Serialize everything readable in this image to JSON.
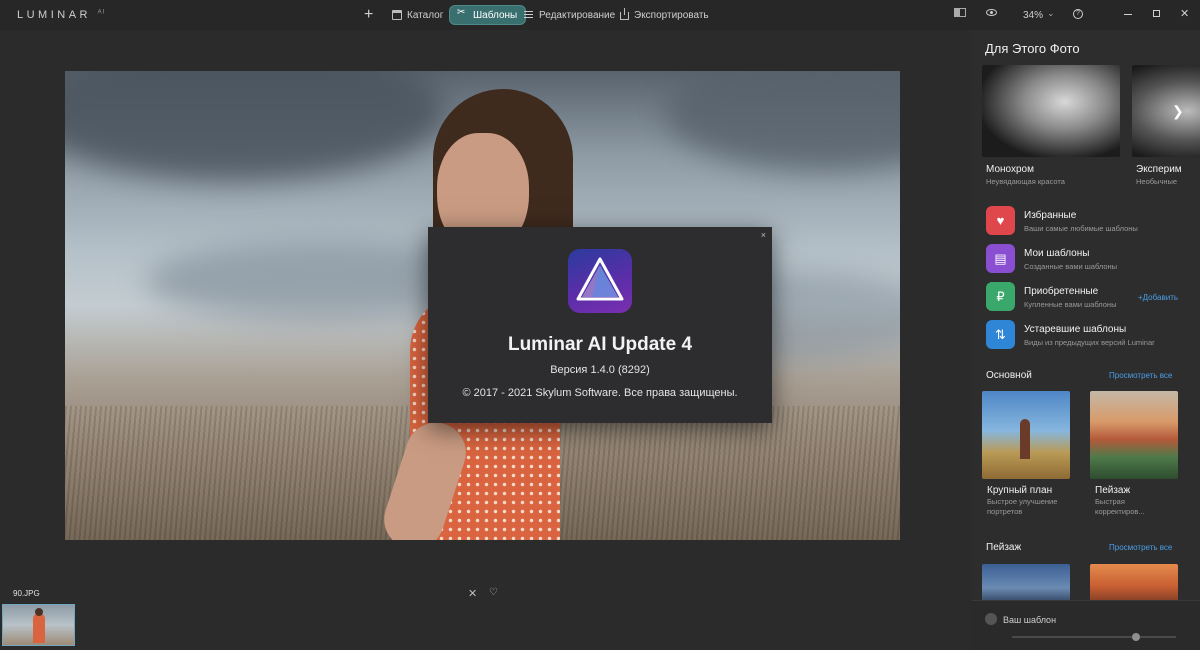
{
  "app": {
    "logo": "LUMINAR",
    "logo_sup": "AI"
  },
  "toolbar": {
    "add": "+",
    "catalog": "Каталог",
    "templates": "Шаблоны",
    "edit": "Редактирование",
    "export": "Экспортировать",
    "zoom": "34%",
    "zoom_chevron": "⌄",
    "help": "?",
    "close": "✕"
  },
  "dialog": {
    "close": "×",
    "title": "Luminar AI Update 4",
    "version": "Версия 1.4.0 (8292)",
    "copyright": "© 2017 - 2021 Skylum Software. Все права защищены."
  },
  "filmstrip": {
    "filename": "90.JPG",
    "reject": "✕",
    "favorite": "♡"
  },
  "panel": {
    "title": "Для Этого Фото",
    "featured": [
      {
        "name": "Монохром",
        "sub": "Неувядающая красота"
      },
      {
        "name": "Эксперим",
        "sub": "Необычные"
      }
    ],
    "featured_arrow": "❯",
    "categories": [
      {
        "name": "Избранные",
        "sub": "Ваши самые любимые шаблоны",
        "icon": "heart-icon",
        "color": "#e0474c",
        "glyph": "♥"
      },
      {
        "name": "Мои шаблоны",
        "sub": "Созданные вами шаблоны",
        "icon": "my-templates-icon",
        "color": "#8a4fd1",
        "glyph": "▤"
      },
      {
        "name": "Приобретенные",
        "sub": "Купленные вами шаблоны",
        "icon": "purchased-icon",
        "color": "#3aa86a",
        "glyph": "₽",
        "add": "+Добавить"
      },
      {
        "name": "Устаревшие шаблоны",
        "sub": "Виды из предыдущих версий Luminar",
        "icon": "legacy-icon",
        "color": "#2f86d6",
        "glyph": "⇅"
      }
    ],
    "section_main": {
      "title": "Основной",
      "link": "Просмотреть все"
    },
    "main_templates": [
      {
        "name": "Крупный план",
        "sub": "Быстрое улучшение портретов"
      },
      {
        "name": "Пейзаж",
        "sub": "Быстрая корректиров..."
      }
    ],
    "section_landscape": {
      "title": "Пейзаж",
      "link": "Просмотреть все"
    },
    "your_template": "Ваш шаблон"
  }
}
